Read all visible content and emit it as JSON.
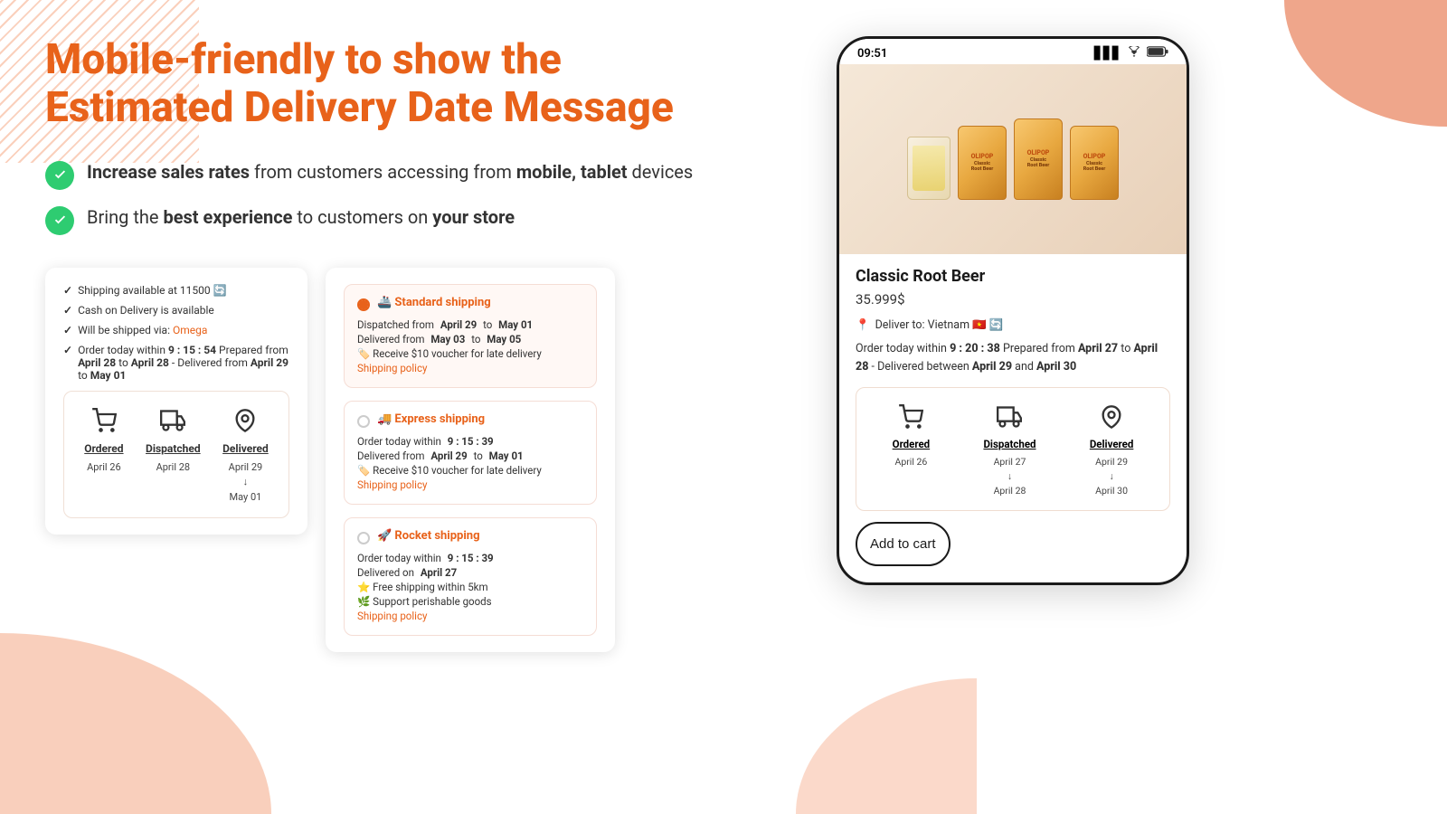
{
  "headline": {
    "line1": "Mobile-friendly to show the",
    "line2": "Estimated Delivery Date Message"
  },
  "features": [
    {
      "id": "feature-1",
      "text_html": "<strong>Increase sales rates</strong> from customers accessing from <strong>mobile, tablet</strong> devices"
    },
    {
      "id": "feature-2",
      "text_html": "Bring the <strong>best experience</strong> to customers on <strong>your store</strong>"
    }
  ],
  "small_card": {
    "items": [
      {
        "icon": "✓",
        "text": "Shipping available at 11500 🔄"
      },
      {
        "icon": "✓",
        "text": "Cash on Delivery is available"
      },
      {
        "icon": "✓",
        "text": "Will be shipped via: Omega",
        "has_link": true,
        "link_text": "Omega"
      },
      {
        "icon": "✓",
        "text": "Order today within 9 : 15 : 54 Prepared from April 28 to April 28 - Delivered from April 29 to May 01"
      }
    ],
    "timeline": {
      "steps": [
        {
          "label": "Ordered",
          "dates": [
            "April 26"
          ]
        },
        {
          "label": "Dispatched",
          "dates": [
            "April 28"
          ]
        },
        {
          "label": "Delivered",
          "dates": [
            "April 29",
            "↓",
            "May 01"
          ]
        }
      ]
    }
  },
  "shipping_options": [
    {
      "id": "standard",
      "emoji": "🚢",
      "title": "Standard shipping",
      "rows": [
        {
          "text": "Dispatched from April 29 to May 01",
          "bold_parts": [
            "April 29",
            "May 01"
          ]
        },
        {
          "text": "Delivered from May 03 to May 05",
          "bold_parts": [
            "May 03",
            "May 05"
          ]
        },
        {
          "text": "🏷️ Receive $10 voucher for late delivery"
        },
        {
          "text": "Shipping policy",
          "is_link": true
        }
      ],
      "selected": true
    },
    {
      "id": "express",
      "emoji": "🚚",
      "title": "Express shipping",
      "rows": [
        {
          "text": "Order today within 9 : 15 : 39",
          "bold_parts": [
            "9 : 15 : 39"
          ]
        },
        {
          "text": "Delivered from April 29 to May 01",
          "bold_parts": [
            "April 29",
            "May 01"
          ]
        },
        {
          "text": "🏷️ Receive $10 voucher for late delivery"
        },
        {
          "text": "Shipping policy",
          "is_link": true
        }
      ],
      "selected": false
    },
    {
      "id": "rocket",
      "emoji": "🚀",
      "title": "Rocket shipping",
      "rows": [
        {
          "text": "Order today within 9 : 15 : 39",
          "bold_parts": [
            "9 : 15 : 39"
          ]
        },
        {
          "text": "Delivered on April 27",
          "bold_parts": [
            "April 27"
          ]
        },
        {
          "text": "⭐ Free shipping within 5km"
        },
        {
          "text": "🌿 Support perishable goods"
        },
        {
          "text": "Shipping policy",
          "is_link": true
        }
      ],
      "selected": false
    }
  ],
  "phone": {
    "status_bar": {
      "time": "09:51"
    },
    "product": {
      "name": "Classic Root Beer",
      "price": "35.999$"
    },
    "delivery": {
      "deliver_to": "Deliver to: Vietnam 🇻🇳 🔄",
      "countdown_label": "Order today within",
      "countdown_time": "9 : 20 : 38",
      "prepared_label": "Prepared from",
      "prepared_dates": "April 27 to April 28",
      "delivered_label": "- Delivered between",
      "delivered_dates": "April 29 and April 30"
    },
    "timeline": {
      "steps": [
        {
          "label": "Ordered",
          "dates": [
            "April 26"
          ]
        },
        {
          "label": "Dispatched",
          "dates": [
            "April 27",
            "↓",
            "April 28"
          ]
        },
        {
          "label": "Delivered",
          "dates": [
            "April 29",
            "↓",
            "April 30"
          ]
        }
      ]
    },
    "add_to_cart_label": "Add to cart"
  }
}
